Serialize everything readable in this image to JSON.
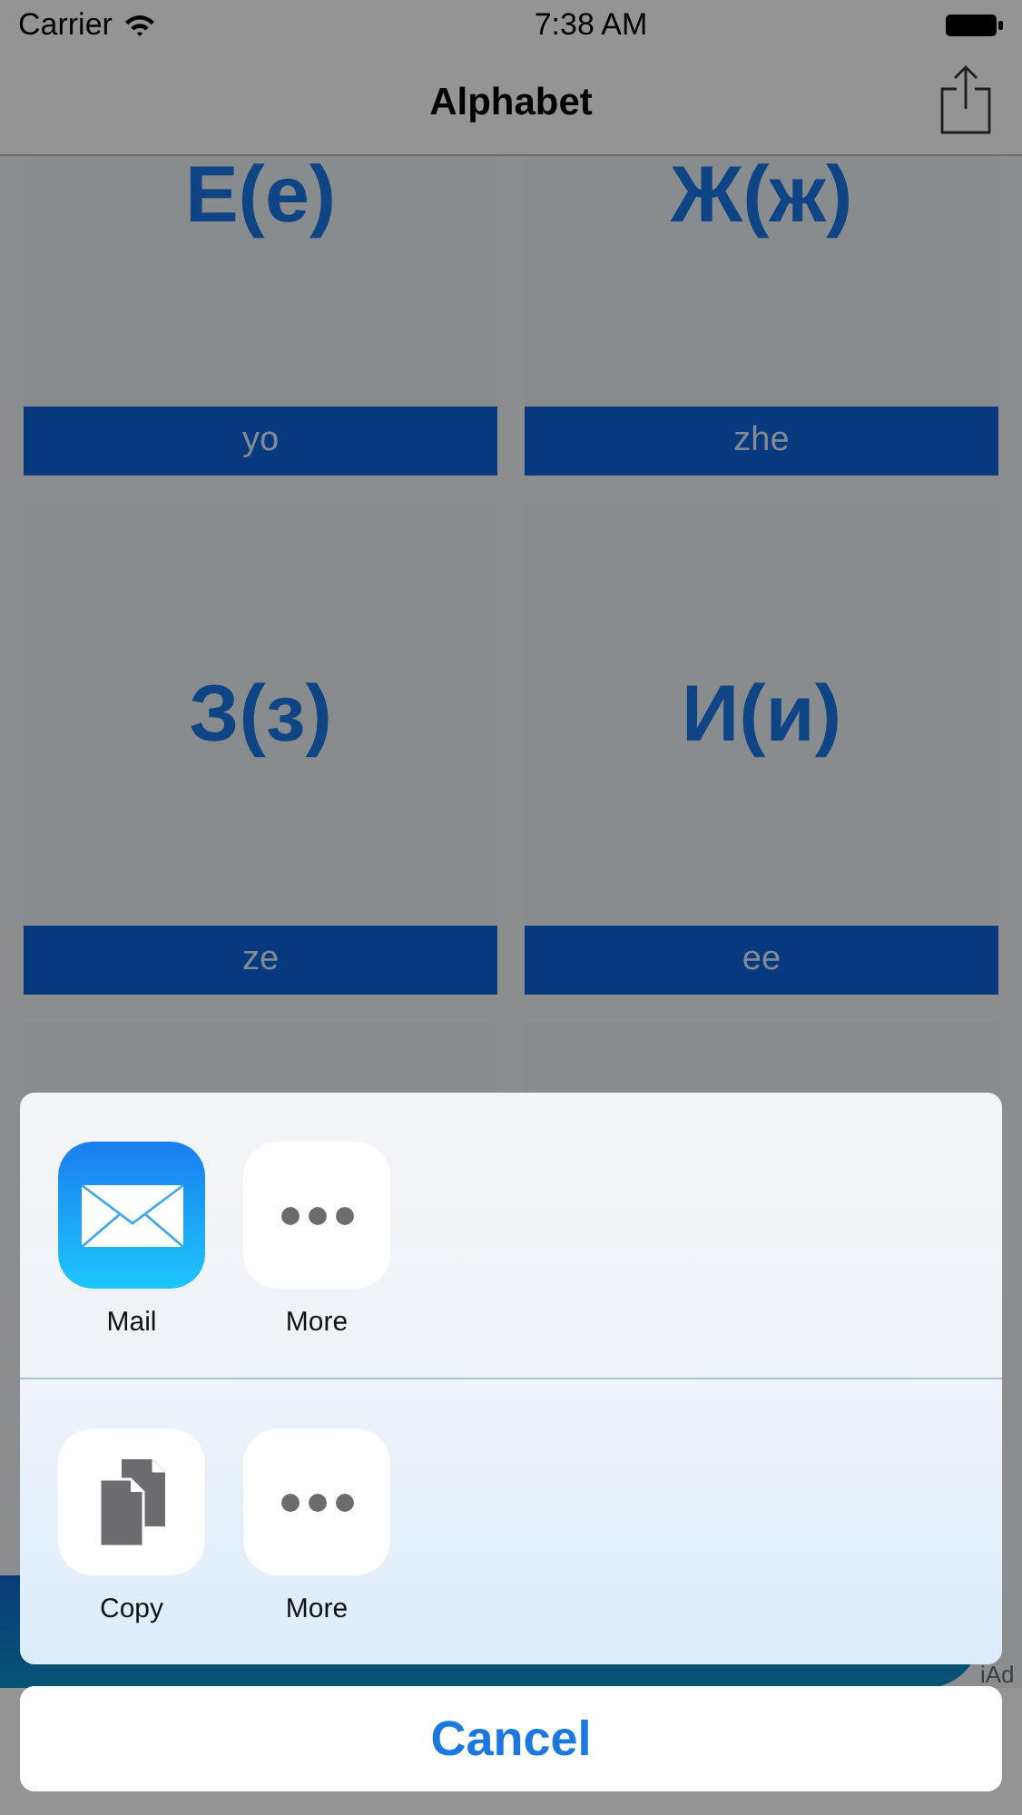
{
  "status_bar": {
    "carrier": "Carrier",
    "time": "7:38 AM"
  },
  "nav": {
    "title": "Alphabet"
  },
  "cards": [
    {
      "kind": "letter",
      "letter": "Е(е)",
      "name": "yo"
    },
    {
      "kind": "letter",
      "letter": "Ж(ж)",
      "name": "zhe"
    },
    {
      "kind": "letter",
      "letter": "З(з)",
      "name": "ze"
    },
    {
      "kind": "letter",
      "letter": "И(и)",
      "name": "ee"
    },
    {
      "kind": "blank"
    },
    {
      "kind": "blank"
    }
  ],
  "ad": {
    "label": "iAd"
  },
  "share_sheet": {
    "rows": [
      {
        "items": [
          {
            "kind": "mail",
            "label": "Mail"
          },
          {
            "kind": "more",
            "label": "More"
          }
        ]
      },
      {
        "items": [
          {
            "kind": "copy",
            "label": "Copy"
          },
          {
            "kind": "more",
            "label": "More"
          }
        ]
      }
    ],
    "cancel": "Cancel"
  }
}
